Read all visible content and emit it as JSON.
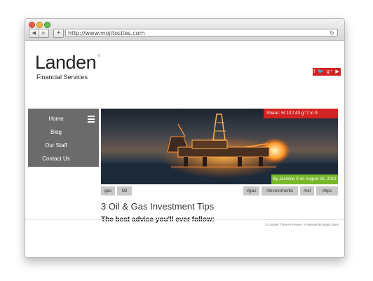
{
  "browser": {
    "url": "http://www.mojitosites.com",
    "back_icon": "◀",
    "forward_icon": "▶",
    "add_tab_icon": "+",
    "reload_icon": "↻"
  },
  "site": {
    "logo_title": "Landen",
    "logo_reg": "®",
    "logo_subtitle": "Financial Services",
    "social_icons": "f 🐦 g⁺ ▶",
    "accent_red": "#d32424",
    "accent_green": "#77b82a"
  },
  "nav": {
    "items": [
      {
        "label": "Home"
      },
      {
        "label": "Blog"
      },
      {
        "label": "Our Staff"
      },
      {
        "label": "Contact Us"
      }
    ]
  },
  "hero": {
    "share_label": "Share:",
    "share_email_icon": "✉",
    "share_counts": "13  f 43  g⁺7  in 9",
    "byline": "By Jasmine S on August 26, 2013"
  },
  "categories": [
    "gas",
    "Oil"
  ],
  "tags": [
    "#gas",
    "#investments",
    "#oil",
    "#tips"
  ],
  "post": {
    "title": "3 Oil & Gas Investment Tips",
    "subtitle": "The best advice you'll ever follow:"
  },
  "footer": {
    "text": "© Landen Theme Preview - Powered By Mojito Sites"
  }
}
